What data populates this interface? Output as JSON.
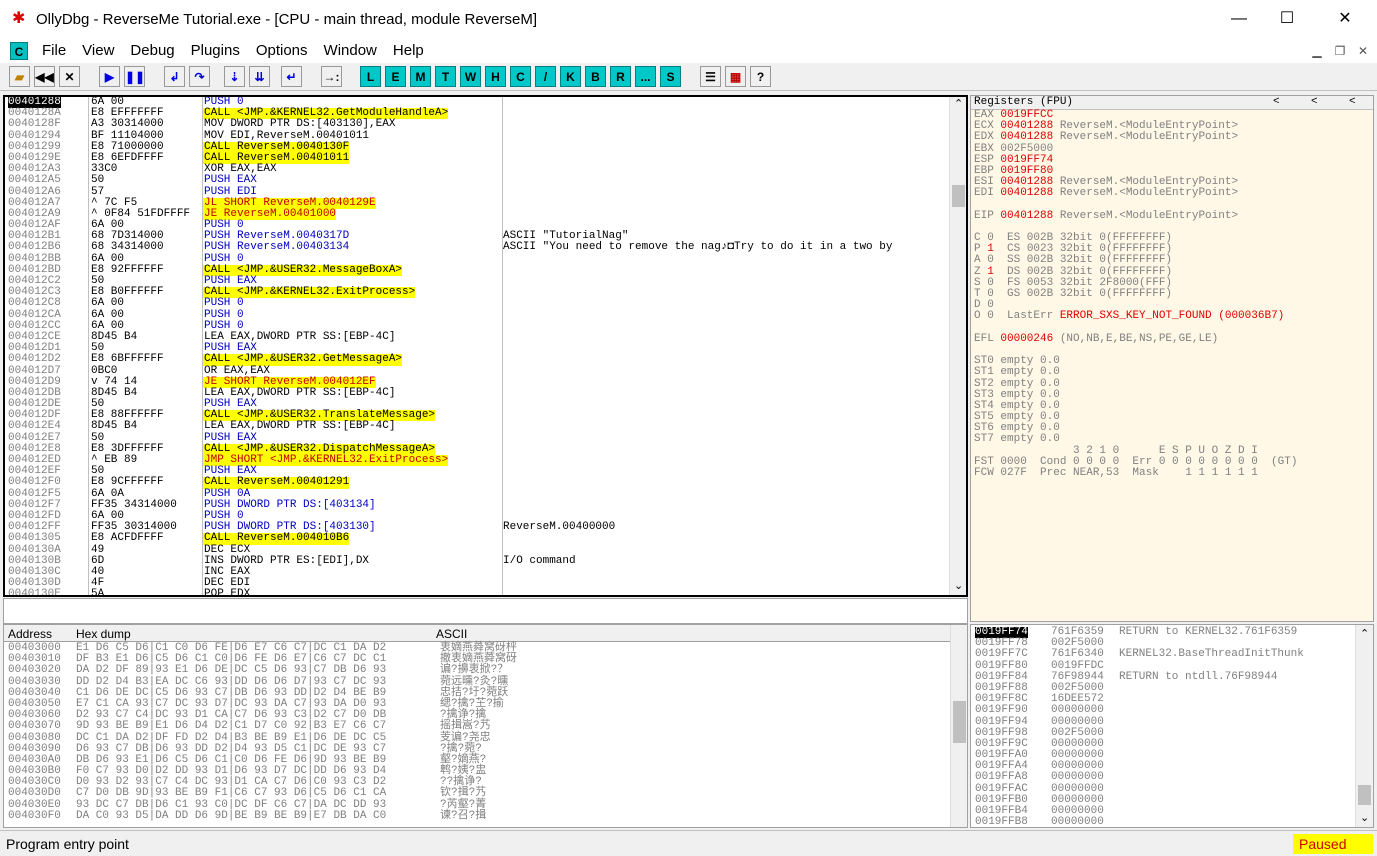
{
  "window": {
    "title": "OllyDbg - ReverseMe Tutorial.exe - [CPU - main thread, module ReverseM]",
    "minimize": "—",
    "maximize": "☐",
    "close": "✕"
  },
  "menu": {
    "icon_label": "C",
    "items": [
      "File",
      "View",
      "Debug",
      "Plugins",
      "Options",
      "Window",
      "Help"
    ]
  },
  "toolbar": {
    "letters": [
      "L",
      "E",
      "M",
      "T",
      "W",
      "H",
      "C",
      "/",
      "K",
      "B",
      "R",
      "...",
      "S"
    ]
  },
  "cpu": {
    "rows": [
      {
        "addr": "00401288",
        "hex": "6A 00",
        "asm": "PUSH 0",
        "com": "",
        "sel": true,
        "kind": "push"
      },
      {
        "addr": "0040128A",
        "hex": "E8 EFFFFFFF",
        "asm": "CALL <JMP.&KERNEL32.GetModuleHandleA>",
        "com": "",
        "kind": "call"
      },
      {
        "addr": "0040128F",
        "hex": "A3 30314000",
        "asm": "MOV DWORD PTR DS:[403130],EAX",
        "com": ""
      },
      {
        "addr": "00401294",
        "hex": "BF 11104000",
        "asm": "MOV EDI,ReverseM.00401011",
        "com": ""
      },
      {
        "addr": "00401299",
        "hex": "E8 71000000",
        "asm": "CALL ReverseM.0040130F",
        "com": "",
        "kind": "call"
      },
      {
        "addr": "0040129E",
        "hex": "E8 6EFDFFFF",
        "asm": "CALL ReverseM.00401011",
        "com": "",
        "kind": "call"
      },
      {
        "addr": "004012A3",
        "hex": "33C0",
        "asm": "XOR EAX,EAX",
        "com": ""
      },
      {
        "addr": "004012A5",
        "hex": "50",
        "asm": "PUSH EAX",
        "com": "",
        "kind": "push"
      },
      {
        "addr": "004012A6",
        "hex": "57",
        "asm": "PUSH EDI",
        "com": "",
        "kind": "push"
      },
      {
        "addr": "004012A7",
        "hex": "^ 7C F5",
        "asm": "JL SHORT ReverseM.0040129E",
        "com": "",
        "kind": "jmp"
      },
      {
        "addr": "004012A9",
        "hex": "^ 0F84 51FDFFFF",
        "asm": "JE ReverseM.00401000",
        "com": "",
        "kind": "jmp"
      },
      {
        "addr": "004012AF",
        "hex": "6A 00",
        "asm": "PUSH 0",
        "com": "",
        "kind": "push"
      },
      {
        "addr": "004012B1",
        "hex": "68 7D314000",
        "asm": "PUSH ReverseM.0040317D",
        "com": "ASCII \"TutorialNag\"",
        "kind": "push"
      },
      {
        "addr": "004012B6",
        "hex": "68 34314000",
        "asm": "PUSH ReverseM.00403134",
        "com": "ASCII \"You need to remove the nag♪◘Try to do it in a two by",
        "kind": "push"
      },
      {
        "addr": "004012BB",
        "hex": "6A 00",
        "asm": "PUSH 0",
        "com": "",
        "kind": "push"
      },
      {
        "addr": "004012BD",
        "hex": "E8 92FFFFFF",
        "asm": "CALL <JMP.&USER32.MessageBoxA>",
        "com": "",
        "kind": "call"
      },
      {
        "addr": "004012C2",
        "hex": "50",
        "asm": "PUSH EAX",
        "com": "",
        "kind": "push"
      },
      {
        "addr": "004012C3",
        "hex": "E8 B0FFFFFF",
        "asm": "CALL <JMP.&KERNEL32.ExitProcess>",
        "com": "",
        "kind": "call"
      },
      {
        "addr": "004012C8",
        "hex": "6A 00",
        "asm": "PUSH 0",
        "com": "",
        "kind": "push"
      },
      {
        "addr": "004012CA",
        "hex": "6A 00",
        "asm": "PUSH 0",
        "com": "",
        "kind": "push"
      },
      {
        "addr": "004012CC",
        "hex": "6A 00",
        "asm": "PUSH 0",
        "com": "",
        "kind": "push"
      },
      {
        "addr": "004012CE",
        "hex": "8D45 B4",
        "asm": "LEA EAX,DWORD PTR SS:[EBP-4C]",
        "com": "",
        "kind": "lea"
      },
      {
        "addr": "004012D1",
        "hex": "50",
        "asm": "PUSH EAX",
        "com": "",
        "kind": "push"
      },
      {
        "addr": "004012D2",
        "hex": "E8 6BFFFFFF",
        "asm": "CALL <JMP.&USER32.GetMessageA>",
        "com": "",
        "kind": "call"
      },
      {
        "addr": "004012D7",
        "hex": "0BC0",
        "asm": "OR EAX,EAX",
        "com": ""
      },
      {
        "addr": "004012D9",
        "hex": "v 74 14",
        "asm": "JE SHORT ReverseM.004012EF",
        "com": "",
        "kind": "jmp"
      },
      {
        "addr": "004012DB",
        "hex": "8D45 B4",
        "asm": "LEA EAX,DWORD PTR SS:[EBP-4C]",
        "com": "",
        "kind": "lea"
      },
      {
        "addr": "004012DE",
        "hex": "50",
        "asm": "PUSH EAX",
        "com": "",
        "kind": "push"
      },
      {
        "addr": "004012DF",
        "hex": "E8 88FFFFFF",
        "asm": "CALL <JMP.&USER32.TranslateMessage>",
        "com": "",
        "kind": "call"
      },
      {
        "addr": "004012E4",
        "hex": "8D45 B4",
        "asm": "LEA EAX,DWORD PTR SS:[EBP-4C]",
        "com": "",
        "kind": "lea"
      },
      {
        "addr": "004012E7",
        "hex": "50",
        "asm": "PUSH EAX",
        "com": "",
        "kind": "push"
      },
      {
        "addr": "004012E8",
        "hex": "E8 3DFFFFFF",
        "asm": "CALL <JMP.&USER32.DispatchMessageA>",
        "com": "",
        "kind": "call"
      },
      {
        "addr": "004012ED",
        "hex": "^ EB 89",
        "asm": "JMP SHORT <JMP.&KERNEL32.ExitProcess>",
        "com": "",
        "kind": "jmp"
      },
      {
        "addr": "004012EF",
        "hex": "50",
        "asm": "PUSH EAX",
        "com": "",
        "kind": "push"
      },
      {
        "addr": "004012F0",
        "hex": "E8 9CFFFFFF",
        "asm": "CALL ReverseM.00401291",
        "com": "",
        "kind": "call"
      },
      {
        "addr": "004012F5",
        "hex": "6A 0A",
        "asm": "PUSH 0A",
        "com": "",
        "kind": "push"
      },
      {
        "addr": "004012F7",
        "hex": "FF35 34314000",
        "asm": "PUSH DWORD PTR DS:[403134]",
        "com": "",
        "kind": "push"
      },
      {
        "addr": "004012FD",
        "hex": "6A 00",
        "asm": "PUSH 0",
        "com": "",
        "kind": "push"
      },
      {
        "addr": "004012FF",
        "hex": "FF35 30314000",
        "asm": "PUSH DWORD PTR DS:[403130]",
        "com": "ReverseM.00400000",
        "kind": "push"
      },
      {
        "addr": "00401305",
        "hex": "E8 ACFDFFFF",
        "asm": "CALL ReverseM.004010B6",
        "com": "",
        "kind": "call"
      },
      {
        "addr": "0040130A",
        "hex": "49",
        "asm": "DEC ECX",
        "com": ""
      },
      {
        "addr": "0040130B",
        "hex": "6D",
        "asm": "INS DWORD PTR ES:[EDI],DX",
        "com": "I/O command"
      },
      {
        "addr": "0040130C",
        "hex": "40",
        "asm": "INC EAX",
        "com": ""
      },
      {
        "addr": "0040130D",
        "hex": "4F",
        "asm": "DEC EDI",
        "com": ""
      },
      {
        "addr": "0040130E",
        "hex": "5A",
        "asm": "POP EDX",
        "com": ""
      }
    ]
  },
  "info": {
    "text": ""
  },
  "registers": {
    "header": "Registers (FPU)",
    "arrows": [
      "<",
      "<",
      "<"
    ],
    "lines": [
      {
        "a": "EAX ",
        "b": "0019FFCC",
        "c": "",
        "red": true
      },
      {
        "a": "ECX ",
        "b": "00401288",
        "c": " ReverseM.<ModuleEntryPoint>",
        "red": true
      },
      {
        "a": "EDX ",
        "b": "00401288",
        "c": " ReverseM.<ModuleEntryPoint>",
        "red": true
      },
      {
        "a": "EBX ",
        "b": "002F5000",
        "c": "",
        "red": false
      },
      {
        "a": "ESP ",
        "b": "0019FF74",
        "c": "",
        "red": true
      },
      {
        "a": "EBP ",
        "b": "0019FF80",
        "c": "",
        "red": true
      },
      {
        "a": "ESI ",
        "b": "00401288",
        "c": " ReverseM.<ModuleEntryPoint>",
        "red": true
      },
      {
        "a": "EDI ",
        "b": "00401288",
        "c": " ReverseM.<ModuleEntryPoint>",
        "red": true
      },
      {
        "a": "",
        "b": "",
        "c": "",
        "red": false
      },
      {
        "a": "EIP ",
        "b": "00401288",
        "c": " ReverseM.<ModuleEntryPoint>",
        "red": true
      },
      {
        "a": "",
        "b": "",
        "c": "",
        "red": false
      },
      {
        "a": "C 0  ES 002B 32bit 0(FFFFFFFF)",
        "b": "",
        "c": "",
        "red": false
      },
      {
        "a": "P ",
        "b": "1",
        "c": "  CS 0023 32bit 0(FFFFFFFF)",
        "red": true
      },
      {
        "a": "A 0  SS 002B 32bit 0(FFFFFFFF)",
        "b": "",
        "c": "",
        "red": false
      },
      {
        "a": "Z ",
        "b": "1",
        "c": "  DS 002B 32bit 0(FFFFFFFF)",
        "red": true
      },
      {
        "a": "S 0  FS 0053 32bit 2F8000(FFF)",
        "b": "",
        "c": "",
        "red": false
      },
      {
        "a": "T 0  GS 002B 32bit 0(FFFFFFFF)",
        "b": "",
        "c": "",
        "red": false
      },
      {
        "a": "D 0",
        "b": "",
        "c": "",
        "red": false
      },
      {
        "a": "O 0  LastErr ",
        "b": "ERROR_SXS_KEY_NOT_FOUND (000036B7)",
        "c": "",
        "red": true
      },
      {
        "a": "",
        "b": "",
        "c": "",
        "red": false
      },
      {
        "a": "EFL ",
        "b": "00000246",
        "c": " (NO,NB,E,BE,NS,PE,GE,LE)",
        "red": true
      },
      {
        "a": "",
        "b": "",
        "c": "",
        "red": false
      },
      {
        "a": "ST0 empty 0.0",
        "b": "",
        "c": "",
        "red": false
      },
      {
        "a": "ST1 empty 0.0",
        "b": "",
        "c": "",
        "red": false
      },
      {
        "a": "ST2 empty 0.0",
        "b": "",
        "c": "",
        "red": false
      },
      {
        "a": "ST3 empty 0.0",
        "b": "",
        "c": "",
        "red": false
      },
      {
        "a": "ST4 empty 0.0",
        "b": "",
        "c": "",
        "red": false
      },
      {
        "a": "ST5 empty 0.0",
        "b": "",
        "c": "",
        "red": false
      },
      {
        "a": "ST6 empty 0.0",
        "b": "",
        "c": "",
        "red": false
      },
      {
        "a": "ST7 empty 0.0",
        "b": "",
        "c": "",
        "red": false
      },
      {
        "a": "               3 2 1 0      E S P U O Z D I",
        "b": "",
        "c": "",
        "red": false
      },
      {
        "a": "FST 0000  Cond 0 0 0 0  Err 0 0 0 0 0 0 0 0  (GT)",
        "b": "",
        "c": "",
        "red": false
      },
      {
        "a": "FCW 027F  Prec NEAR,53  Mask    1 1 1 1 1 1",
        "b": "",
        "c": "",
        "red": false
      }
    ]
  },
  "dump": {
    "headers": {
      "address": "Address",
      "hex": "Hex dump",
      "ascii": "ASCII"
    },
    "rows": [
      {
        "addr": "00403000",
        "hex": "E1 D6 C5 D6|C1 C0 D6 FE|D6 E7 C6 C7|DC C1 DA D2",
        "ascii": "衷嫡燕蕣窝砑枰"
      },
      {
        "addr": "00403010",
        "hex": "DF B3 E1 D6|C5 D6 C1 C0|D6 FE D6 E7|C6 C7 DC C1",
        "ascii": "撤衷嫡燕蕣窝砑"
      },
      {
        "addr": "00403020",
        "hex": "DA D2 DF 89|93 E1 D6 DE|DC C5 D6 93|C7 DB D6 93",
        "ascii": "谝?擤衷掀?？"
      },
      {
        "addr": "00403030",
        "hex": "DD D2 D4 B3|EA DC C6 93|DD D6 D6 D7|93 C7 DC 93",
        "ascii": "菀远曛?灸?曛"
      },
      {
        "addr": "00403040",
        "hex": "C1 D6 DE DC|C5 D6 93 C7|DB D6 93 DD|D2 D4 BE B9",
        "ascii": "忠拮?圩?菀跃"
      },
      {
        "addr": "00403050",
        "hex": "E7 C1 CA 93|C7 DC 93 D7|DC 93 DA C7|93 DA D0 93",
        "ascii": "缌?擒?芏?揄"
      },
      {
        "addr": "00403060",
        "hex": "D2 93 C7 C4|DC 93 D1 CA|C7 D6 93 C3|D2 C7 D0 DB",
        "ascii": "?擒诤?擒"
      },
      {
        "addr": "00403070",
        "hex": "9D 93 BE B9|E1 D6 D4 D2|C1 D7 C0 92|B3 E7 C6 C7",
        "ascii": "摇揖嵩?艿"
      },
      {
        "addr": "00403080",
        "hex": "DC C1 DA D2|DF FD D2 D4|B3 BE B9 E1|D6 DE DC C5",
        "ascii": "芰谝?尧忠"
      },
      {
        "addr": "00403090",
        "hex": "D6 93 C7 DB|D6 93 DD D2|D4 93 D5 C1|DC DE 93 C7",
        "ascii": "?擒?菀?"
      },
      {
        "addr": "004030A0",
        "hex": "DB D6 93 E1|D6 C5 D6 C1|C0 D6 FE D6|9D 93 BE B9",
        "ascii": "壑?嫡燕?"
      },
      {
        "addr": "004030B0",
        "hex": "F0 C7 93 D0|D2 DD 93 D1|D6 93 D7 DC|DD D6 93 D4",
        "ascii": "鹎?姨?盅"
      },
      {
        "addr": "004030C0",
        "hex": "D0 93 D2 93|C7 C4 DC 93|D1 CA C7 D6|C0 93 C3 D2",
        "ascii": "??擒诤?"
      },
      {
        "addr": "004030D0",
        "hex": "C7 D0 DB 9D|93 BE B9 F1|C6 C7 93 D6|C5 D6 C1 CA",
        "ascii": "钦?揖?艿"
      },
      {
        "addr": "004030E0",
        "hex": "93 DC C7 DB|D6 C1 93 C0|DC DF C6 C7|DA DC DD 93",
        "ascii": "?芮壑?菁"
      },
      {
        "addr": "004030F0",
        "hex": "DA C0 93 D5|DA DD D6 9D|BE B9 BE B9|E7 DB DA C0",
        "ascii": "谏?召?揖"
      }
    ]
  },
  "stack": {
    "rows": [
      {
        "addr": "0019FF74",
        "val": "761F6359",
        "com": "RETURN to KERNEL32.761F6359",
        "sel": true
      },
      {
        "addr": "0019FF78",
        "val": "002F5000",
        "com": ""
      },
      {
        "addr": "0019FF7C",
        "val": "761F6340",
        "com": "KERNEL32.BaseThreadInitThunk"
      },
      {
        "addr": "0019FF80",
        "val": "0019FFDC",
        "com": ""
      },
      {
        "addr": "0019FF84",
        "val": "76F98944",
        "com": "RETURN to ntdll.76F98944"
      },
      {
        "addr": "0019FF88",
        "val": "002F5000",
        "com": ""
      },
      {
        "addr": "0019FF8C",
        "val": "16DEE572",
        "com": ""
      },
      {
        "addr": "0019FF90",
        "val": "00000000",
        "com": ""
      },
      {
        "addr": "0019FF94",
        "val": "00000000",
        "com": ""
      },
      {
        "addr": "0019FF98",
        "val": "002F5000",
        "com": ""
      },
      {
        "addr": "0019FF9C",
        "val": "00000000",
        "com": ""
      },
      {
        "addr": "0019FFA0",
        "val": "00000000",
        "com": ""
      },
      {
        "addr": "0019FFA4",
        "val": "00000000",
        "com": ""
      },
      {
        "addr": "0019FFA8",
        "val": "00000000",
        "com": ""
      },
      {
        "addr": "0019FFAC",
        "val": "00000000",
        "com": ""
      },
      {
        "addr": "0019FFB0",
        "val": "00000000",
        "com": ""
      },
      {
        "addr": "0019FFB4",
        "val": "00000000",
        "com": ""
      },
      {
        "addr": "0019FFB8",
        "val": "00000000",
        "com": ""
      }
    ]
  },
  "status": {
    "text": "Program entry point",
    "state": "Paused"
  }
}
